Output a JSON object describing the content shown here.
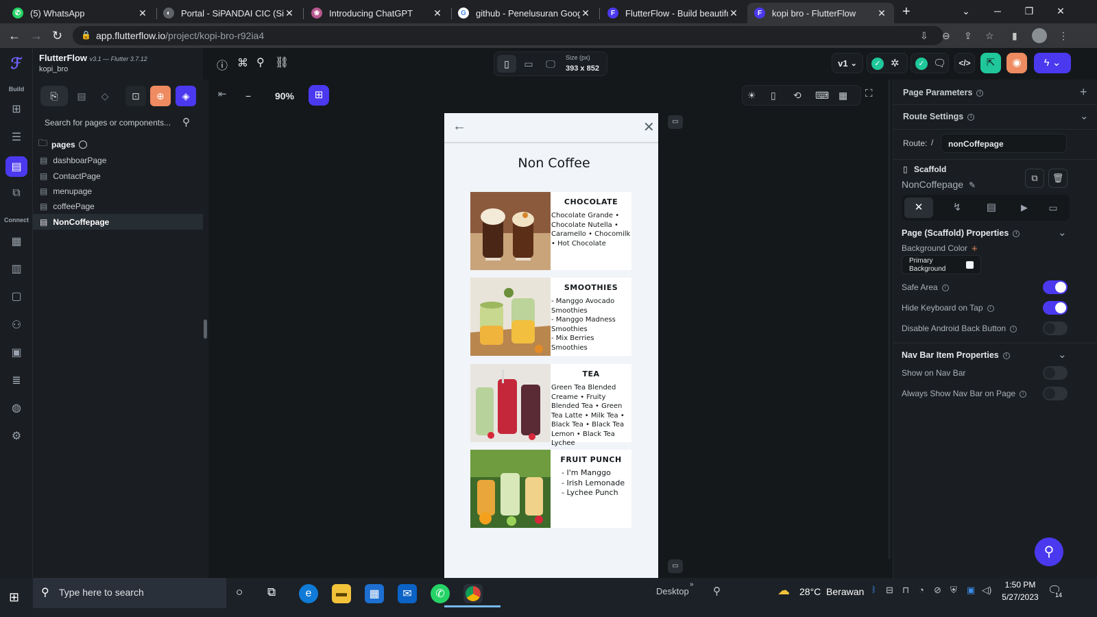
{
  "browser": {
    "tabs": [
      {
        "title": "(5) WhatsApp",
        "favicon_color": "#25d366",
        "favicon_char": "✆"
      },
      {
        "title": "Portal - SiPANDAI CIC (Sistem",
        "favicon_color": "#5f6368",
        "favicon_char": "◐"
      },
      {
        "title": "Introducing ChatGPT",
        "favicon_color": "#b8578f",
        "favicon_char": "❀"
      },
      {
        "title": "github - Penelusuran Google",
        "favicon_color": "#4285f4",
        "favicon_char": "G"
      },
      {
        "title": "FlutterFlow - Build beautiful, r",
        "favicon_color": "#4b39ef",
        "favicon_char": "F"
      },
      {
        "title": "kopi bro - FlutterFlow",
        "favicon_color": "#4b39ef",
        "favicon_char": "F"
      }
    ],
    "url_host": "app.flutterflow.io",
    "url_path": "/project/kopi-bro-r92ia4"
  },
  "app": {
    "name": "FlutterFlow",
    "version": "v3.1 — Flutter 3.7.12",
    "project": "kopi_bro",
    "rail": {
      "build_label": "Build",
      "connect_label": "Connect"
    }
  },
  "left_panel": {
    "search_placeholder": "Search for pages or components...",
    "folder_label": "pages",
    "pages": [
      "dashboarPage",
      "ContactPage",
      "menupage",
      "coffeePage",
      "NonCoffepage"
    ],
    "selected_page": "NonCoffepage"
  },
  "toolbar": {
    "zoom": "90%",
    "size_label": "Size (px)",
    "size_value": "393 x 852",
    "version": "v1"
  },
  "phone": {
    "title": "Non Coffee",
    "cards": [
      {
        "title": "CHOCOLATE",
        "desc": "Chocolate Grande • Chocolate Nutella • Caramello • Chocomilk • Hot Chocolate"
      },
      {
        "title": "SMOOTHIES",
        "desc": "- Manggo Avocado Smoothies\n- Manggo Madness Smoothies\n- Mix Berries Smoothies"
      },
      {
        "title": "TEA",
        "desc": "Green Tea Blended Creame • Fruity Blended Tea • Green Tea Latte • Milk Tea • Black Tea • Black Tea Lemon • Black Tea Lychee"
      },
      {
        "title": "FRUIT PUNCH",
        "desc": "- I'm Manggo\n- Irish Lemonade\n- Lychee Punch"
      }
    ]
  },
  "right_panel": {
    "page_parameters": "Page Parameters",
    "route_settings": "Route Settings",
    "route_label": "Route:",
    "route_slash": "/",
    "route_value": "nonCoffepage",
    "scaffold_label": "Scaffold",
    "scaffold_name": "NonCoffepage",
    "scaffold_props": "Page (Scaffold) Properties",
    "bg_color_label": "Background Color",
    "bg_color_value": "Primary Background",
    "safe_area": "Safe Area",
    "safe_area_on": true,
    "hide_keyboard": "Hide Keyboard on Tap",
    "hide_keyboard_on": true,
    "disable_back": "Disable Android Back Button",
    "disable_back_on": false,
    "nav_bar_props": "Nav Bar Item Properties",
    "show_nav_bar": "Show on Nav Bar",
    "show_nav_bar_on": false,
    "always_show_nav": "Always Show Nav Bar on Page",
    "always_show_nav_on": false
  },
  "taskbar": {
    "search_placeholder": "Type here to search",
    "desktop_label": "Desktop",
    "weather": "28°C  Berawan",
    "time": "1:50 PM",
    "date": "5/27/2023",
    "notif_count": "14"
  },
  "colors": {
    "accent": "#4b39ef",
    "bg": "#14181b",
    "panel": "#1a1e22",
    "phone_bg": "#f1f4f8"
  }
}
